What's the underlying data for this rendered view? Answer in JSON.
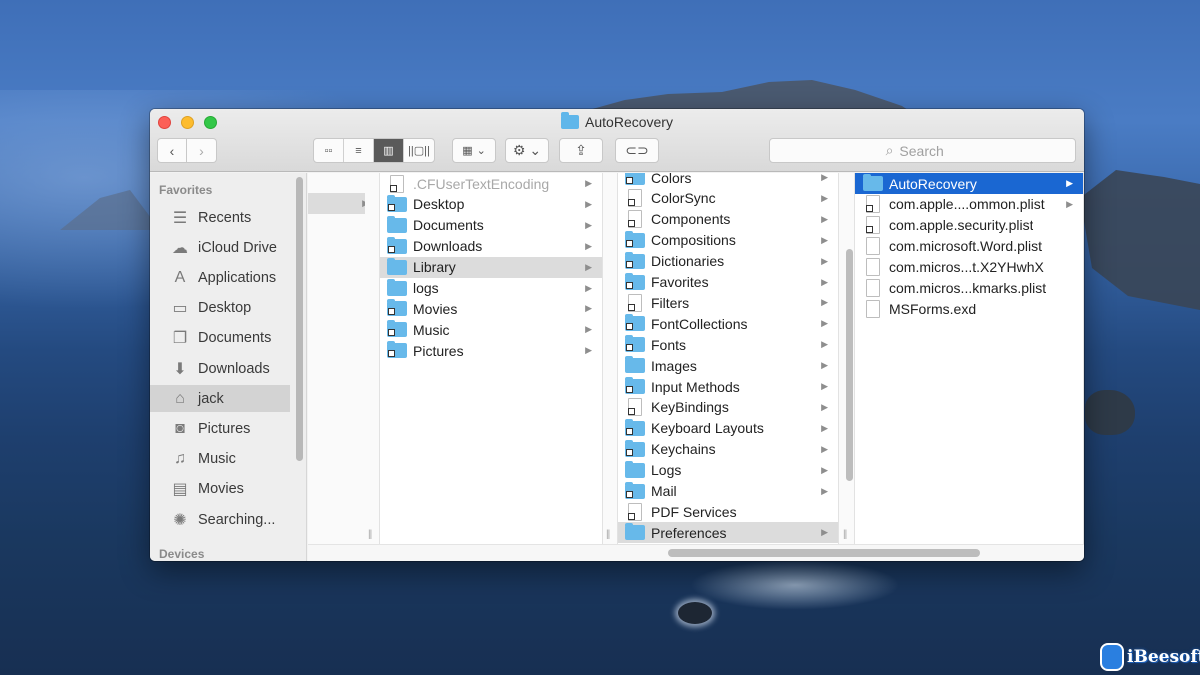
{
  "window": {
    "title": "AutoRecovery"
  },
  "toolbar": {
    "back_icon": "‹",
    "forward_icon": "›",
    "views": [
      {
        "name": "icon-view",
        "glyph": "▫▫",
        "active": false
      },
      {
        "name": "list-view",
        "glyph": "≡",
        "active": false
      },
      {
        "name": "column-view",
        "glyph": "▥",
        "active": true
      },
      {
        "name": "gallery-view",
        "glyph": "||▢||",
        "active": false
      }
    ],
    "arrange_glyph": "▦",
    "action_glyph": "⚙",
    "dropdown_glyph": "⌄",
    "share_glyph": "⇪",
    "tag_glyph": "⊂⊃",
    "search_placeholder": "Search",
    "search_icon": "⌕"
  },
  "sidebar": {
    "favorites_label": "Favorites",
    "devices_label": "Devices",
    "items": [
      {
        "label": "Recents",
        "icon": "☰"
      },
      {
        "label": "iCloud Drive",
        "icon": "☁"
      },
      {
        "label": "Applications",
        "icon": "A"
      },
      {
        "label": "Desktop",
        "icon": "▭"
      },
      {
        "label": "Documents",
        "icon": "❐"
      },
      {
        "label": "Downloads",
        "icon": "⬇"
      },
      {
        "label": "jack",
        "icon": "⌂",
        "selected": true
      },
      {
        "label": "Pictures",
        "icon": "◙"
      },
      {
        "label": "Music",
        "icon": "♫"
      },
      {
        "label": "Movies",
        "icon": "▤"
      },
      {
        "label": "Searching...",
        "icon": "✺"
      }
    ]
  },
  "columns": {
    "home": [
      {
        "label": ".CFUserTextEncoding",
        "type": "doc-alias",
        "dim": true,
        "arrow": true
      },
      {
        "label": "Desktop",
        "type": "folder-alias",
        "arrow": true
      },
      {
        "label": "Documents",
        "type": "folder",
        "arrow": true
      },
      {
        "label": "Downloads",
        "type": "folder-alias",
        "arrow": true
      },
      {
        "label": "Library",
        "type": "folder",
        "arrow": true,
        "highlight": true
      },
      {
        "label": "logs",
        "type": "folder",
        "arrow": true
      },
      {
        "label": "Movies",
        "type": "folder-alias",
        "arrow": true
      },
      {
        "label": "Music",
        "type": "folder-alias",
        "arrow": true
      },
      {
        "label": "Pictures",
        "type": "folder-alias",
        "arrow": true
      }
    ],
    "library": [
      {
        "label": "Colors",
        "type": "folder-alias",
        "arrow": true
      },
      {
        "label": "ColorSync",
        "type": "doc-alias",
        "arrow": true
      },
      {
        "label": "Components",
        "type": "doc-alias",
        "arrow": true
      },
      {
        "label": "Compositions",
        "type": "folder-alias",
        "arrow": true
      },
      {
        "label": "Dictionaries",
        "type": "folder-alias",
        "arrow": true
      },
      {
        "label": "Favorites",
        "type": "folder-alias",
        "arrow": true
      },
      {
        "label": "Filters",
        "type": "doc-alias",
        "arrow": true
      },
      {
        "label": "FontCollections",
        "type": "folder-alias",
        "arrow": true
      },
      {
        "label": "Fonts",
        "type": "folder-alias",
        "arrow": true
      },
      {
        "label": "Images",
        "type": "folder",
        "arrow": true
      },
      {
        "label": "Input Methods",
        "type": "folder-alias",
        "arrow": true
      },
      {
        "label": "KeyBindings",
        "type": "doc-alias",
        "arrow": true
      },
      {
        "label": "Keyboard Layouts",
        "type": "folder-alias",
        "arrow": true
      },
      {
        "label": "Keychains",
        "type": "folder-alias",
        "arrow": true
      },
      {
        "label": "Logs",
        "type": "folder",
        "arrow": true
      },
      {
        "label": "Mail",
        "type": "folder-alias",
        "arrow": true
      },
      {
        "label": "PDF Services",
        "type": "doc-alias",
        "arrow": false
      },
      {
        "label": "Preferences",
        "type": "folder",
        "arrow": true,
        "highlight": true
      }
    ],
    "preferences": [
      {
        "label": "AutoRecovery",
        "type": "folder",
        "arrow": true,
        "selected": true
      },
      {
        "label": "com.apple....ommon.plist",
        "type": "doc-alias",
        "arrow": true
      },
      {
        "label": "com.apple.security.plist",
        "type": "doc-alias",
        "arrow": false
      },
      {
        "label": "com.microsoft.Word.plist",
        "type": "doc",
        "arrow": false
      },
      {
        "label": "com.micros...t.X2YHwhX",
        "type": "doc",
        "arrow": false
      },
      {
        "label": "com.micros...kmarks.plist",
        "type": "doc",
        "arrow": false
      },
      {
        "label": "MSForms.exd",
        "type": "doc",
        "arrow": false
      }
    ]
  },
  "watermark": {
    "text": "iBeesoft"
  },
  "colors": {
    "selection": "#1a67d2",
    "folder": "#67b9ea"
  }
}
